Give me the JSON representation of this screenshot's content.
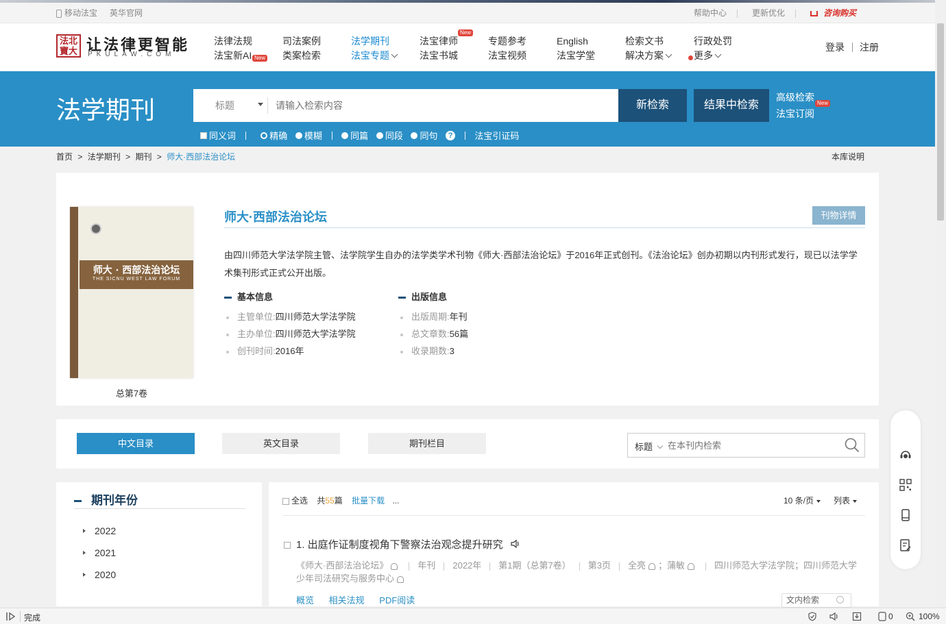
{
  "topbar": {
    "mobile": "移动法宝",
    "english_site": "英华官网",
    "help": "帮助中心",
    "updates": "更新优化",
    "buy": "咨询购买"
  },
  "logo": {
    "seal": "法北寶大",
    "brand": "让法律更智能",
    "brand_sub": "PKULAW.COM"
  },
  "nav": [
    {
      "l1": "法律法规",
      "l2": "法宝新AI",
      "new": "New"
    },
    {
      "l1": "司法案例",
      "l2": "类案检索"
    },
    {
      "l1": "法学期刊",
      "l2": "法宝专题"
    },
    {
      "l1": "法宝律师",
      "l2": "法宝书城",
      "new": "New"
    },
    {
      "l1": "专题参考",
      "l2": "法宝视频"
    },
    {
      "l1": "English",
      "l2": "法宝学堂"
    },
    {
      "l1": "检索文书",
      "l2": "解决方案"
    },
    {
      "l1": "行政处罚",
      "l2": "更多"
    }
  ],
  "auth": {
    "login": "登录",
    "register": "注册"
  },
  "banner": {
    "title": "法学期刊",
    "scope": "标题",
    "placeholder": "请输入检索内容",
    "new_search": "新检索",
    "in_results": "结果中检索",
    "advanced": "高级检索",
    "subscribe": "法宝订阅",
    "new_tag": "New",
    "options": {
      "synonym": "同义词",
      "exact": "精确",
      "fuzzy": "模糊",
      "same_article": "同篇",
      "same_para": "同段",
      "same_sentence": "同句",
      "help": "?",
      "cite_code": "法宝引证码"
    }
  },
  "breadcrumb": {
    "home": "首页",
    "journals": "法学期刊",
    "issue": "期刊",
    "current": "师大·西部法治论坛",
    "sep": ">"
  },
  "lib_info": "本库说明",
  "journal": {
    "title": "师大·西部法治论坛",
    "detail_btn": "刊物详情",
    "intro": "由四川师范大学法学院主管、法学院学生自办的法学类学术刊物《师大·西部法治论坛》于2016年正式创刊。《法治论坛》创办初期以内刊形式发行，现已以法学学术集刊形式正式公开出版。",
    "cover_title": "师大 · 西部法治论坛",
    "cover_sub": "THE SICNU WEST LAW FORUM",
    "volume": "总第7卷",
    "basic_head": "基本信息",
    "pub_head": "出版信息",
    "basic": [
      {
        "k": "主管单位:",
        "v": "四川师范大学法学院"
      },
      {
        "k": "主办单位:",
        "v": "四川师范大学法学院"
      },
      {
        "k": "创刊时间:",
        "v": "2016年"
      }
    ],
    "pub": [
      {
        "k": "出版周期:",
        "v": "年刊"
      },
      {
        "k": "总文章数:",
        "v": "56篇"
      },
      {
        "k": "收录期数:",
        "v": "3"
      }
    ]
  },
  "tabs": {
    "cn": "中文目录",
    "en": "英文目录",
    "columns": "期刊栏目",
    "search_scope": "标题",
    "search_placeholder": "在本刊内检索"
  },
  "years": {
    "head": "期刊年份",
    "list": [
      "2022",
      "2021",
      "2020"
    ]
  },
  "list": {
    "select_all": "全选",
    "total_pre": "共",
    "total": "55",
    "total_post": "篇",
    "batch": "批量下载",
    "more": "...",
    "page_size": "10 条/页",
    "view": "列表"
  },
  "article": {
    "title": "1. 出庭作证制度视角下警察法治观念提升研究",
    "journal": "《师大·西部法治论坛》",
    "cycle": "年刊",
    "year": "2022年",
    "issue": "第1期（总第7卷）",
    "page": "第3页",
    "author1": "全亮",
    "author2": "蒲敏",
    "org": "四川师范大学法学院；四川师范大学少年司法研究与服务中心",
    "links": [
      "概览",
      "相关法规",
      "PDF阅读"
    ],
    "in_text": "文内检索"
  },
  "status": {
    "done": "完成",
    "count": "0",
    "zoom": "100%"
  },
  "colors": {
    "accent": "#2a8fc6",
    "dark_button": "#1c5179",
    "buy_red": "#d8312b",
    "new_red": "#e0453b"
  }
}
